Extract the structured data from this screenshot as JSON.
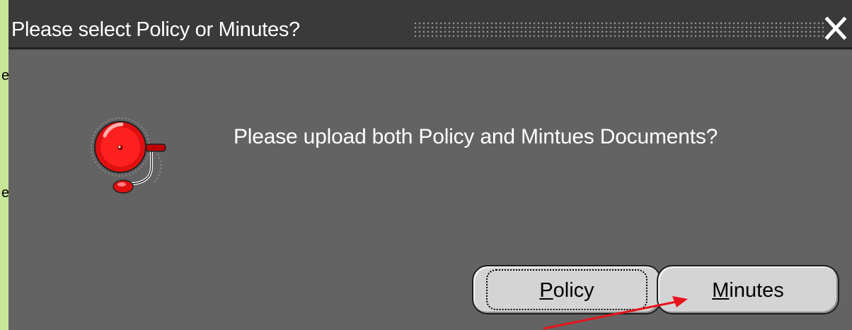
{
  "dialog": {
    "title": "Please select Policy or Minutes?",
    "message": "Please upload both Policy and Mintues Documents?",
    "icon": "bell-icon",
    "close_icon": "close-icon"
  },
  "buttons": {
    "policy_label": "Policy",
    "minutes_label": "Minutes"
  },
  "background_strip": {
    "glyphs": [
      "e",
      "e"
    ]
  },
  "annotation": {
    "arrow_color": "#e8141c",
    "points_to": "minutes-button"
  },
  "colors": {
    "dialog_bg": "#636363",
    "titlebar_bg": "#3a3a3a",
    "button_bg": "#d4d4d4",
    "bell_red": "#e01010",
    "strip_green": "#c8e69a"
  }
}
